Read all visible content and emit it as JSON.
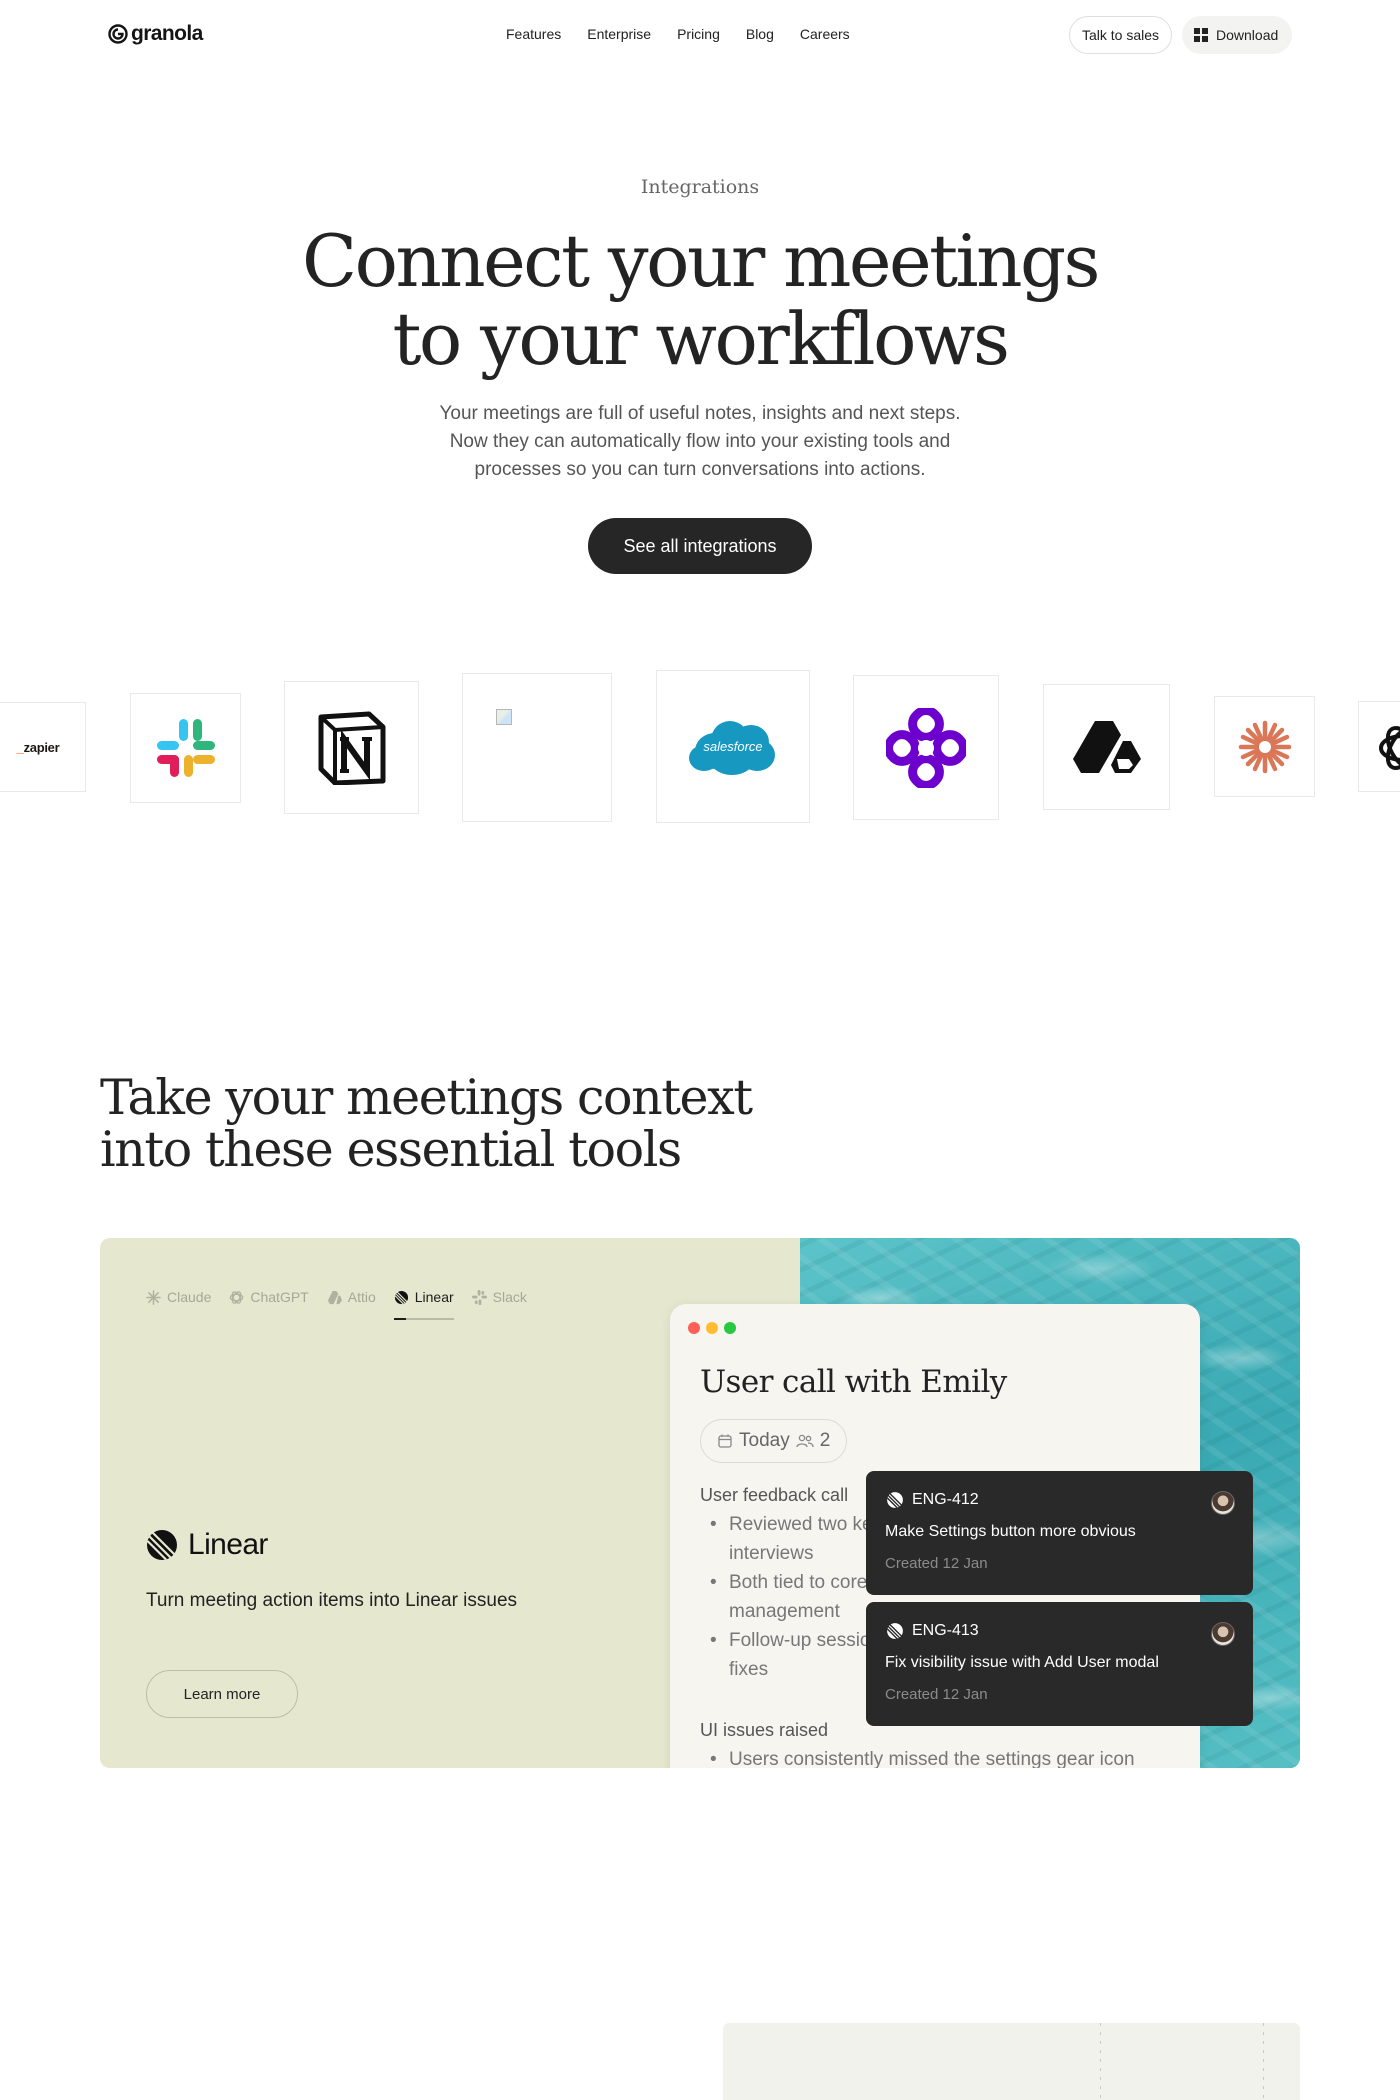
{
  "nav": {
    "logo": "granola",
    "links": [
      "Features",
      "Enterprise",
      "Pricing",
      "Blog",
      "Careers"
    ],
    "talk_to_sales": "Talk to sales",
    "download": "Download"
  },
  "hero": {
    "eyebrow": "Integrations",
    "title_line1": "Connect your meetings",
    "title_line2": "to your workflows",
    "subtitle_line1": "Your meetings are full of useful notes, insights and next steps.",
    "subtitle_line2": "Now they can automatically flow into your existing tools and",
    "subtitle_line3": "processes so you can turn conversations into actions.",
    "cta": "See all integrations"
  },
  "logo_strip": {
    "zapier": "zapier",
    "salesforce": "salesforce",
    "icons": [
      "zapier-icon",
      "slack-icon",
      "notion-icon",
      "broken-image-icon",
      "salesforce-icon",
      "make-icon",
      "attio-icon",
      "claude-icon",
      "openai-icon"
    ]
  },
  "section2": {
    "title_line1": "Take your meetings context",
    "title_line2": "into these essential tools",
    "tabs": [
      "Claude",
      "ChatGPT",
      "Attio",
      "Linear",
      "Slack"
    ],
    "active_tab": "Linear",
    "brand": "Linear",
    "description": "Turn meeting action items into Linear issues",
    "learn_more": "Learn more",
    "card_bg": "#e5e8cf"
  },
  "note": {
    "title": "User call with Emily",
    "chip_date": "Today",
    "chip_count": "2",
    "heading1": "User feedback call",
    "bullets1": [
      "Reviewed two key",
      "interviews",
      "Both tied to core",
      "management",
      "Follow-up sessio",
      "fixes"
    ],
    "heading2": "UI issues raised",
    "bullets2": [
      "Users consistently missed the settings gear icon"
    ]
  },
  "issues": [
    {
      "id": "ENG-412",
      "title": "Make Settings button more obvious",
      "meta": "Created 12 Jan"
    },
    {
      "id": "ENG-413",
      "title": "Fix visibility issue with Add User modal",
      "meta": "Created 12 Jan"
    }
  ],
  "colors": {
    "cta_bg": "#262626",
    "issue_bg": "#292929",
    "water": "#3aa9b3"
  }
}
